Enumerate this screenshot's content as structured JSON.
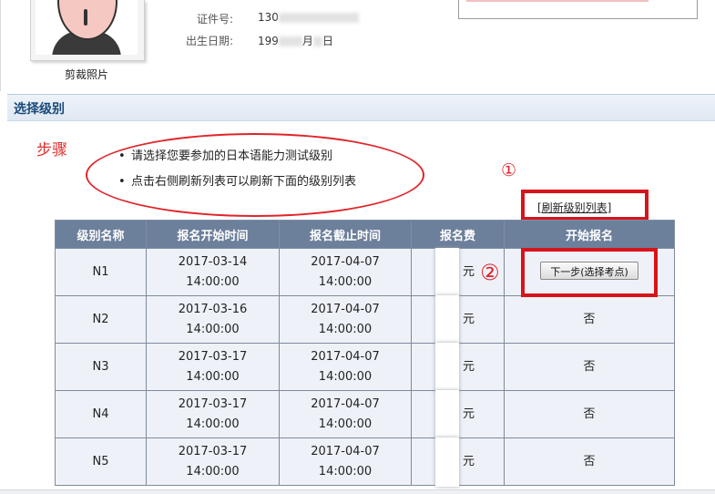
{
  "profile": {
    "photo_caption": "剪裁照片",
    "id_label": "证件号:",
    "id_value_prefix": "130",
    "birth_label": "出生日期:",
    "birth_value_prefix": "199",
    "birth_month_suffix": "月",
    "birth_day_suffix": "日"
  },
  "section": {
    "title": "选择级别"
  },
  "annotations": {
    "step_label": "步骤",
    "marker_1": "①",
    "marker_2": "②"
  },
  "instructions": [
    "请选择您要参加的日本语能力测试级别",
    "点击右侧刷新列表可以刷新下面的级别列表"
  ],
  "refresh_link": "[刷新级别列表]",
  "table": {
    "headers": [
      "级别名称",
      "报名开始时间",
      "报名截止时间",
      "报名费",
      "开始报名"
    ],
    "rows": [
      {
        "level": "N1",
        "start_date": "2017-03-14",
        "start_time": "14:00:00",
        "end_date": "2017-04-07",
        "end_time": "14:00:00",
        "fee_unit": "元",
        "action": "下一步(选择考点)"
      },
      {
        "level": "N2",
        "start_date": "2017-03-16",
        "start_time": "14:00:00",
        "end_date": "2017-04-07",
        "end_time": "14:00:00",
        "fee_unit": "元",
        "action": "否"
      },
      {
        "level": "N3",
        "start_date": "2017-03-17",
        "start_time": "14:00:00",
        "end_date": "2017-04-07",
        "end_time": "14:00:00",
        "fee_unit": "元",
        "action": "否"
      },
      {
        "level": "N4",
        "start_date": "2017-03-17",
        "start_time": "14:00:00",
        "end_date": "2017-04-07",
        "end_time": "14:00:00",
        "fee_unit": "元",
        "action": "否"
      },
      {
        "level": "N5",
        "start_date": "2017-03-17",
        "start_time": "14:00:00",
        "end_date": "2017-04-07",
        "end_time": "14:00:00",
        "fee_unit": "元",
        "action": "否"
      }
    ]
  },
  "colors": {
    "header_bg": "#6c7f9b",
    "annotation_red": "#e0242a",
    "section_title": "#1a4a7a"
  }
}
